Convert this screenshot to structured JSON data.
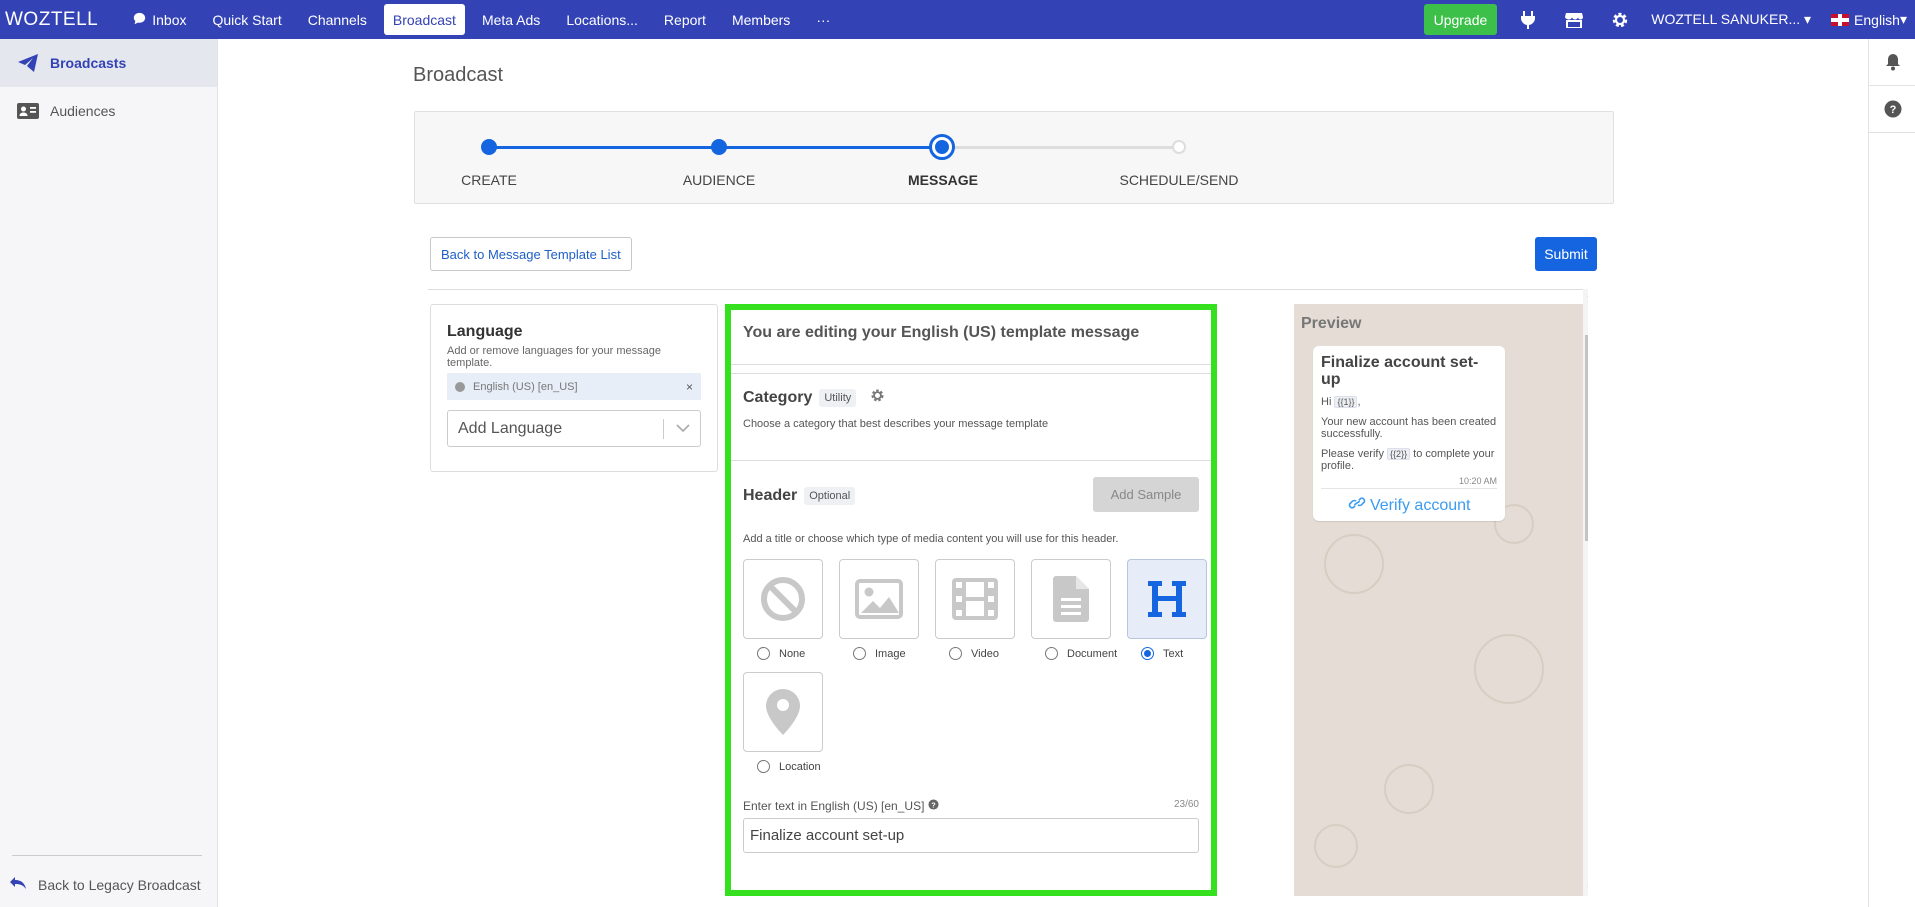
{
  "nav": {
    "logo": "WOZTELL",
    "items": [
      "Inbox",
      "Quick Start",
      "Channels",
      "Broadcast",
      "Meta Ads",
      "Locations...",
      "Report",
      "Members",
      "···"
    ],
    "upgrade": "Upgrade",
    "user": "WOZTELL SANUKER...",
    "language": "English"
  },
  "sidebar": {
    "items": [
      "Broadcasts",
      "Audiences"
    ],
    "legacy": "Back to Legacy Broadcast"
  },
  "page": {
    "title": "Broadcast",
    "steps": [
      "CREATE",
      "AUDIENCE",
      "MESSAGE",
      "SCHEDULE/SEND"
    ],
    "back_button": "Back to Message Template List",
    "submit_button": "Submit"
  },
  "language_card": {
    "title": "Language",
    "description": "Add or remove languages for your message template.",
    "chip": "English (US) [en_US]",
    "chip_remove": "×",
    "add_placeholder": "Add Language"
  },
  "editor": {
    "heading": "You are editing your English (US) template message",
    "category": {
      "title": "Category",
      "value": "Utility",
      "description": "Choose a category that best describes your message template"
    },
    "header": {
      "title": "Header",
      "badge": "Optional",
      "add_sample": "Add Sample",
      "description": "Add a title or choose which type of media content you will use for this header.",
      "options": [
        "None",
        "Image",
        "Video",
        "Document",
        "Text",
        "Location"
      ],
      "selected": "Text",
      "text_label": "Enter text in English (US) [en_US]",
      "counter": "23/60",
      "text_value": "Finalize account set-up"
    }
  },
  "preview": {
    "title": "Preview",
    "bubble_title": "Finalize account set-up",
    "hi": "Hi",
    "var1": "{{1}}",
    "hi_suffix": ",",
    "body1": "Your new account has been created successfully.",
    "body2_pre": "Please verify",
    "var2": "{{2}}",
    "body2_post": "to complete your profile.",
    "time": "10:20 AM",
    "button": "Verify account"
  },
  "colors": {
    "nav": "#3342b5",
    "primary": "#1565e0",
    "upgrade": "#3cc04a",
    "highlight": "#35e01e"
  }
}
